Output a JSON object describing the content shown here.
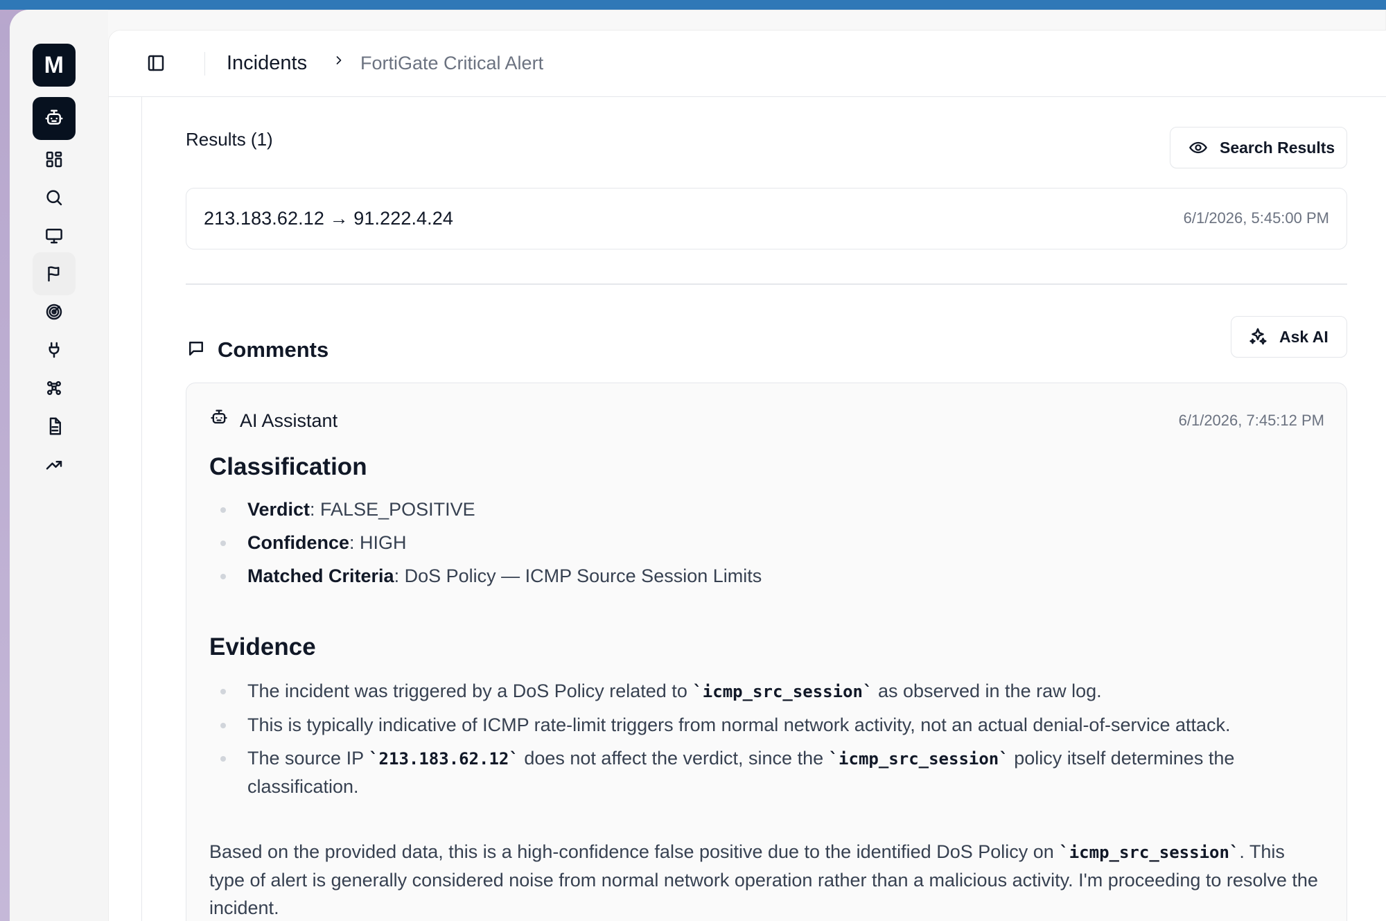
{
  "window": {
    "logo_letter": "M"
  },
  "breadcrumb": {
    "primary": "Incidents",
    "secondary": "FortiGate Critical Alert"
  },
  "results": {
    "title": "Results (1)",
    "search_button_label": "Search Results",
    "item": {
      "route": "213.183.62.12 → 91.222.4.24",
      "timestamp": "6/1/2026, 5:45:00 PM"
    }
  },
  "comments": {
    "title": "Comments",
    "ask_ai_label": "Ask AI",
    "item": {
      "author": "AI Assistant",
      "timestamp": "6/1/2026, 7:45:12 PM",
      "classification_title": "Classification",
      "verdict_label": "Verdict",
      "verdict_value": ": FALSE_POSITIVE",
      "confidence_label": "Confidence",
      "confidence_value": ": HIGH",
      "matched_criteria_label": "Matched Criteria",
      "matched_criteria_value": ": DoS Policy — ICMP Source Session Limits",
      "evidence_title": "Evidence",
      "evidence_1_prefix": "The incident was triggered by a DoS Policy related to ",
      "evidence_1_code": "`icmp_src_session`",
      "evidence_1_suffix": " as observed in the raw log.",
      "evidence_2": "This is typically indicative of ICMP rate-limit triggers from normal network activity, not an actual denial-of-service attack.",
      "evidence_3_prefix": "The source IP ",
      "evidence_3_code_ip": "`213.183.62.12`",
      "evidence_3_middle": " does not affect the verdict, since the ",
      "evidence_3_code_policy": "`icmp_src_session`",
      "evidence_3_suffix": " policy itself determines the classification.",
      "summary_prefix": "Based on the provided data, this is a high-confidence false positive due to the identified DoS Policy on ",
      "summary_code": "`icmp_src_session`",
      "summary_suffix": ". This type of alert is generally considered noise from normal network operation rather than a malicious activity. I'm proceeding to resolve the incident."
    }
  },
  "icons": {
    "logo": "m-logo",
    "nav_active": "robot-icon",
    "nav_dashboard": "grid-icon",
    "nav_search": "search-icon",
    "nav_monitor": "monitor-icon",
    "nav_flag": "flag-icon",
    "nav_radar": "radar-icon",
    "nav_plug": "plug-icon",
    "nav_workflow": "workflow-icon",
    "nav_document": "document-icon",
    "nav_trend": "trend-icon",
    "sidebar_toggle": "sidebar-toggle-icon",
    "breadcrumb_separator": "chevron-right-icon",
    "search_results": "eye-icon",
    "comments": "message-icon",
    "ask_ai": "sparkles-icon",
    "comment_author": "robot-icon"
  },
  "colors": {
    "window_top": "#2f78b7",
    "window_frame": "#b9a7cd",
    "sidebar_bg": "#f5f5f5",
    "accent_dark": "#07111f",
    "border": "#e5e7eb",
    "muted_text": "#6b7280"
  }
}
